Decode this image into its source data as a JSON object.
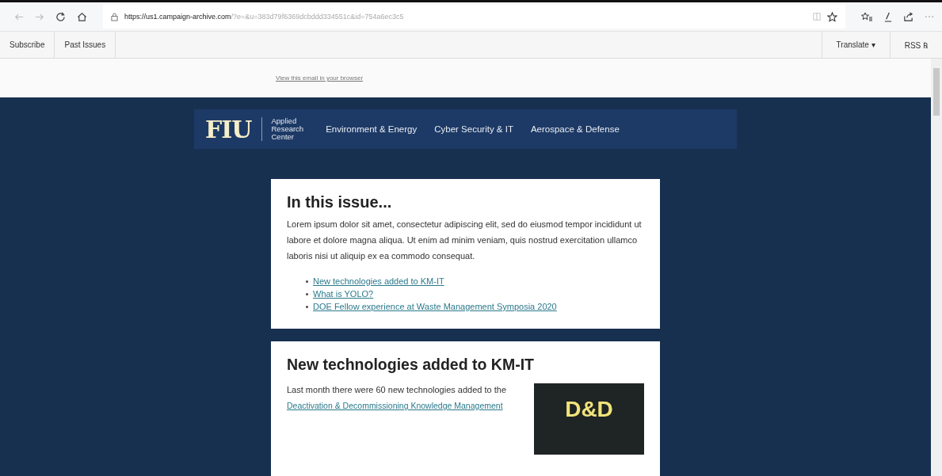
{
  "browser": {
    "url_host": "https://us1.campaign-archive.com",
    "url_rest": "/?e=&u=383d79f6369dcbddd334551c&id=754a6ec3c5"
  },
  "archive_bar": {
    "left": [
      "Subscribe",
      "Past Issues"
    ],
    "translate": "Translate ▾",
    "rss": "RSS ℞"
  },
  "view_in_browser": "View this email in your browser",
  "header": {
    "logo": "FIU",
    "unit": [
      "Applied",
      "Research",
      "Center"
    ],
    "nav": [
      "Environment & Energy",
      "Cyber Security & IT",
      "Aerospace & Defense"
    ]
  },
  "issue": {
    "title": "In this issue...",
    "text": "Lorem ipsum dolor sit amet, consectetur adipiscing elit, sed do eiusmod tempor incididunt ut labore et dolore magna aliqua. Ut enim ad minim veniam, quis nostrud exercitation ullamco laboris nisi ut aliquip ex ea commodo consequat.",
    "links": [
      "New technologies added to KM-IT",
      "What is YOLO?",
      "DOE Fellow experience at Waste Management Symposia 2020"
    ]
  },
  "article": {
    "title": "New technologies added to KM-IT",
    "text_before": "Last month there were 60 new technologies added to the",
    "link": "Deactivation & Decommissioning Knowledge Management",
    "tile_text": "D&D"
  }
}
